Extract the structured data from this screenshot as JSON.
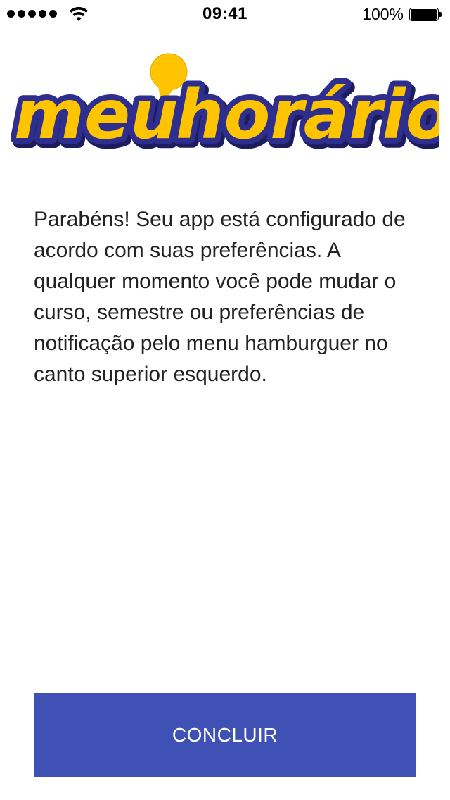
{
  "status_bar": {
    "time": "09:41",
    "battery_percent": "100%",
    "signal_bars": 5,
    "battery_level": 1.0,
    "icons": [
      "signal-dots-icon",
      "wifi-icon",
      "battery-icon"
    ]
  },
  "logo": {
    "text_part1": "meu",
    "text_part2": "horário",
    "colors": {
      "fill": "#ffc400",
      "outline": "#2e2e8f",
      "pin": "#ffc400"
    }
  },
  "message": {
    "text": "Parabéns! Seu app está configurado de acordo com suas preferências. A qualquer momento você pode mudar o curso, semestre ou preferências de notificação pelo menu hamburguer no canto superior esquerdo."
  },
  "actions": {
    "finish_label": "CONCLUIR"
  },
  "colors": {
    "primary": "#3f51b5",
    "text": "#222222",
    "background": "#ffffff"
  }
}
